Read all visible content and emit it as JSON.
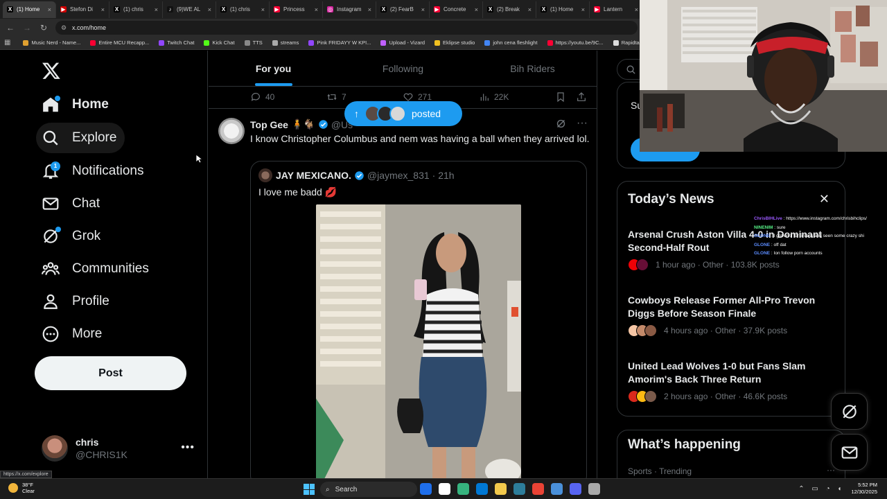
{
  "browser": {
    "tabs": [
      {
        "label": "(1) Home",
        "color": "#000000",
        "glyph": "X",
        "active": true
      },
      {
        "label": "Stefon Di",
        "color": "#d00000",
        "glyph": "▶"
      },
      {
        "label": "(1) chris",
        "color": "#000000",
        "glyph": "X"
      },
      {
        "label": "(9)WE AL",
        "color": "#111111",
        "glyph": "♪"
      },
      {
        "label": "(1) chris",
        "color": "#000000",
        "glyph": "X"
      },
      {
        "label": "Princess",
        "color": "#ff0033",
        "glyph": "▶"
      },
      {
        "label": "Instagram",
        "color": "#d6249f",
        "glyph": "◎"
      },
      {
        "label": "(2) FearB",
        "color": "#000000",
        "glyph": "X"
      },
      {
        "label": "Concrete",
        "color": "#ff0033",
        "glyph": "▶"
      },
      {
        "label": "(2) Break",
        "color": "#000000",
        "glyph": "X"
      },
      {
        "label": "(1) Home",
        "color": "#000000",
        "glyph": "X"
      },
      {
        "label": "Lantern",
        "color": "#ff0033",
        "glyph": "▶"
      }
    ],
    "close_glyph": "×",
    "url": "x.com/home",
    "bookmarks": [
      {
        "label": "Music Nerd - Name...",
        "color": "#e0a030"
      },
      {
        "label": "Entire MCU Recapp...",
        "color": "#ff0033"
      },
      {
        "label": "Twitch Chat",
        "color": "#9146ff"
      },
      {
        "label": "Kick Chat",
        "color": "#53fc18"
      },
      {
        "label": "TTS",
        "color": "#888888"
      },
      {
        "label": "streams",
        "color": "#aaaaaa"
      },
      {
        "label": "Pink FRIDAYY W KPI...",
        "color": "#9146ff"
      },
      {
        "label": "Upload - Vizard",
        "color": "#c060ff"
      },
      {
        "label": "Eklipse studio",
        "color": "#f0c020"
      },
      {
        "label": "john cena fleshlight",
        "color": "#4285f4"
      },
      {
        "label": "https://youtu.be/9C...",
        "color": "#ff0033"
      },
      {
        "label": "Rapidtags | You",
        "color": "#dddddd"
      }
    ]
  },
  "nav": {
    "items": [
      {
        "label": "Home",
        "icon": "home-icon"
      },
      {
        "label": "Explore",
        "icon": "search-icon"
      },
      {
        "label": "Notifications",
        "icon": "bell-icon",
        "badge": "1"
      },
      {
        "label": "Chat",
        "icon": "mail-icon"
      },
      {
        "label": "Grok",
        "icon": "grok-icon"
      },
      {
        "label": "Communities",
        "icon": "communities-icon"
      },
      {
        "label": "Profile",
        "icon": "person-icon"
      },
      {
        "label": "More",
        "icon": "more-circle-icon"
      }
    ],
    "post_label": "Post",
    "account": {
      "name": "chris",
      "handle": "@CHRIS1K",
      "more": "•••"
    },
    "status_url": "https://x.com/explore"
  },
  "feed": {
    "tabs": [
      "For you",
      "Following",
      "Bih Riders"
    ],
    "active_tab": 0,
    "prev_actions": {
      "replies": "40",
      "reposts": "7",
      "likes": "271",
      "views": "22K"
    },
    "posted_pill": {
      "label": "posted",
      "arrow": "↑"
    },
    "tweet": {
      "name": "Top Gee",
      "name_emoji": "🧍🐐",
      "handle": "@Us",
      "text": "I know Christopher Columbus and nem was having a ball when they arrived lol.",
      "more": "···",
      "quote": {
        "name": "JAY MEXICANO.",
        "handle": "@jaymex_831",
        "time": "· 21h",
        "text": "I love me badd 💋"
      }
    }
  },
  "right": {
    "premium_text": "Su... eli...",
    "news": {
      "title": "Today’s News",
      "close": "✕",
      "items": [
        {
          "headline": "Arsenal Crush Aston Villa 4-0 in Dominant Second-Half Rout",
          "meta": "1 hour ago · Other · 103.8K posts",
          "colors": [
            "#ef0107",
            "#670e36"
          ]
        },
        {
          "headline": "Cowboys Release Former All-Pro Trevon Diggs Before Season Finale",
          "meta": "4 hours ago · Other · 37.9K posts",
          "colors": [
            "#f5c6a5",
            "#c48a6a",
            "#8a5a44"
          ]
        },
        {
          "headline": "United Lead Wolves 1-0 but Fans Slam Amorim's Back Three Return",
          "meta": "2 hours ago · Other · 46.6K posts",
          "colors": [
            "#da291c",
            "#fdb913",
            "#7a5a4a"
          ]
        }
      ]
    },
    "happening": {
      "title": "What’s happening",
      "sub": "Sports · Trending",
      "more": "···"
    }
  },
  "chat": [
    {
      "user": "ChrisBIHLive",
      "msg": "https://www.instagram.com/chrisbihclips/",
      "color": "#9b59ff"
    },
    {
      "user": "NINENIM",
      "msg": "sure",
      "color": "#57f287"
    },
    {
      "user": "GLONE",
      "msg": "I got on x for 5 secs and seen some crazy shi",
      "color": "#5b8cff"
    },
    {
      "user": "GLONE",
      "msg": "off dat",
      "color": "#5b8cff"
    },
    {
      "user": "GLONE",
      "msg": "Ion follow porn accounts",
      "color": "#5b8cff"
    }
  ],
  "taskbar": {
    "weather_temp": "38°F",
    "weather_cond": "Clear",
    "search_label": "Search",
    "time": "5:52 PM",
    "date": "12/30/2025",
    "apps": [
      "#1f6feb",
      "#ffffff",
      "#36b37e",
      "#0078d4",
      "#f2c94c",
      "#2d7d9a",
      "#ea4335",
      "#4a90d9",
      "#5865f2",
      "#aaaaaa"
    ]
  },
  "colors": {
    "accent": "#1d9bf0",
    "bg": "#000000",
    "muted": "#71767b",
    "border": "#2f3336"
  }
}
